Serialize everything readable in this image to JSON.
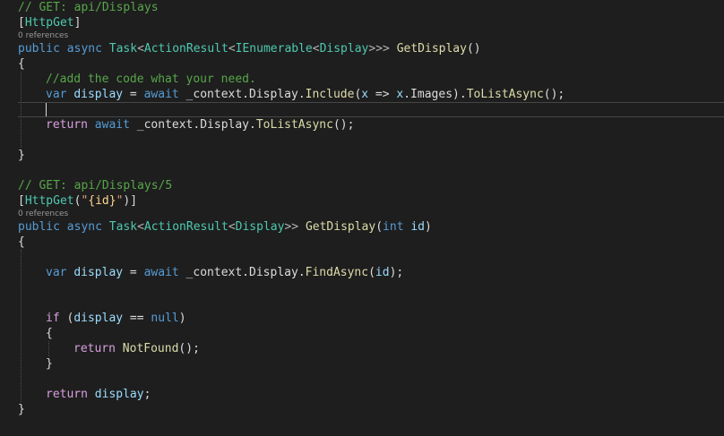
{
  "editor": {
    "colors": {
      "background": "#1e1e1e",
      "comment": "#57a64a",
      "keyword": "#569cd6",
      "control_keyword": "#d8a0df",
      "type": "#4ec9b0",
      "method": "#dcdcaa",
      "variable": "#9cdcfe",
      "string": "#d69d85",
      "plain": "#dcdcdc",
      "codelens": "#999999"
    },
    "lines": [
      {
        "kind": "code",
        "tokens": [
          {
            "t": "// GET: api/Displays",
            "c": "comment"
          }
        ]
      },
      {
        "kind": "code",
        "tokens": [
          {
            "t": "[",
            "c": "plain"
          },
          {
            "t": "HttpGet",
            "c": "attribute"
          },
          {
            "t": "]",
            "c": "plain"
          }
        ]
      },
      {
        "kind": "lens",
        "text": "0 references"
      },
      {
        "kind": "code",
        "tokens": [
          {
            "t": "public",
            "c": "keyword"
          },
          {
            "t": " ",
            "c": "plain"
          },
          {
            "t": "async",
            "c": "keyword"
          },
          {
            "t": " ",
            "c": "plain"
          },
          {
            "t": "Task",
            "c": "type"
          },
          {
            "t": "<",
            "c": "punct"
          },
          {
            "t": "ActionResult",
            "c": "type"
          },
          {
            "t": "<",
            "c": "punct"
          },
          {
            "t": "IEnumerable",
            "c": "type"
          },
          {
            "t": "<",
            "c": "punct"
          },
          {
            "t": "Display",
            "c": "type"
          },
          {
            "t": ">>>",
            "c": "punct"
          },
          {
            "t": " ",
            "c": "plain"
          },
          {
            "t": "GetDisplay",
            "c": "method"
          },
          {
            "t": "()",
            "c": "plain"
          }
        ]
      },
      {
        "kind": "code",
        "tokens": [
          {
            "t": "{",
            "c": "plain"
          }
        ]
      },
      {
        "kind": "code",
        "indent": 1,
        "tokens": [
          {
            "t": "//add the code what your need.",
            "c": "comment"
          }
        ]
      },
      {
        "kind": "code",
        "indent": 1,
        "tokens": [
          {
            "t": "var",
            "c": "keyword"
          },
          {
            "t": " ",
            "c": "plain"
          },
          {
            "t": "display",
            "c": "variable"
          },
          {
            "t": " = ",
            "c": "plain"
          },
          {
            "t": "await",
            "c": "keyword"
          },
          {
            "t": " _context.",
            "c": "plain"
          },
          {
            "t": "Display",
            "c": "plain"
          },
          {
            "t": ".",
            "c": "plain"
          },
          {
            "t": "Include",
            "c": "method"
          },
          {
            "t": "(",
            "c": "plain"
          },
          {
            "t": "x",
            "c": "variable"
          },
          {
            "t": " => ",
            "c": "plain"
          },
          {
            "t": "x",
            "c": "variable"
          },
          {
            "t": ".Images).",
            "c": "plain"
          },
          {
            "t": "ToListAsync",
            "c": "method"
          },
          {
            "t": "();",
            "c": "plain"
          }
        ]
      },
      {
        "kind": "code",
        "indent": 1,
        "current": true,
        "tokens": []
      },
      {
        "kind": "code",
        "indent": 1,
        "tokens": [
          {
            "t": "return",
            "c": "control"
          },
          {
            "t": " ",
            "c": "plain"
          },
          {
            "t": "await",
            "c": "keyword"
          },
          {
            "t": " _context.",
            "c": "plain"
          },
          {
            "t": "Display",
            "c": "plain"
          },
          {
            "t": ".",
            "c": "plain"
          },
          {
            "t": "ToListAsync",
            "c": "method"
          },
          {
            "t": "();",
            "c": "plain"
          }
        ]
      },
      {
        "kind": "code",
        "tokens": []
      },
      {
        "kind": "code",
        "tokens": [
          {
            "t": "}",
            "c": "plain"
          }
        ]
      },
      {
        "kind": "code",
        "tokens": []
      },
      {
        "kind": "code",
        "tokens": [
          {
            "t": "// GET: api/Displays/5",
            "c": "comment"
          }
        ]
      },
      {
        "kind": "code",
        "tokens": [
          {
            "t": "[",
            "c": "plain"
          },
          {
            "t": "HttpGet",
            "c": "attribute"
          },
          {
            "t": "(",
            "c": "plain"
          },
          {
            "t": "\"",
            "c": "string"
          },
          {
            "t": "{id}",
            "c": "format"
          },
          {
            "t": "\"",
            "c": "string"
          },
          {
            "t": ")]",
            "c": "plain"
          }
        ]
      },
      {
        "kind": "lens",
        "text": "0 references"
      },
      {
        "kind": "code",
        "tokens": [
          {
            "t": "public",
            "c": "keyword"
          },
          {
            "t": " ",
            "c": "plain"
          },
          {
            "t": "async",
            "c": "keyword"
          },
          {
            "t": " ",
            "c": "plain"
          },
          {
            "t": "Task",
            "c": "type"
          },
          {
            "t": "<",
            "c": "punct"
          },
          {
            "t": "ActionResult",
            "c": "type"
          },
          {
            "t": "<",
            "c": "punct"
          },
          {
            "t": "Display",
            "c": "type"
          },
          {
            "t": ">>",
            "c": "punct"
          },
          {
            "t": " ",
            "c": "plain"
          },
          {
            "t": "GetDisplay",
            "c": "method"
          },
          {
            "t": "(",
            "c": "plain"
          },
          {
            "t": "int",
            "c": "keyword"
          },
          {
            "t": " ",
            "c": "plain"
          },
          {
            "t": "id",
            "c": "variable"
          },
          {
            "t": ")",
            "c": "plain"
          }
        ]
      },
      {
        "kind": "code",
        "tokens": [
          {
            "t": "{",
            "c": "plain"
          }
        ]
      },
      {
        "kind": "code",
        "tokens": []
      },
      {
        "kind": "code",
        "indent": 1,
        "tokens": [
          {
            "t": "var",
            "c": "keyword"
          },
          {
            "t": " ",
            "c": "plain"
          },
          {
            "t": "display",
            "c": "variable"
          },
          {
            "t": " = ",
            "c": "plain"
          },
          {
            "t": "await",
            "c": "keyword"
          },
          {
            "t": " _context.",
            "c": "plain"
          },
          {
            "t": "Display",
            "c": "plain"
          },
          {
            "t": ".",
            "c": "plain"
          },
          {
            "t": "FindAsync",
            "c": "method"
          },
          {
            "t": "(",
            "c": "plain"
          },
          {
            "t": "id",
            "c": "variable"
          },
          {
            "t": ");",
            "c": "plain"
          }
        ]
      },
      {
        "kind": "code",
        "tokens": []
      },
      {
        "kind": "code",
        "tokens": []
      },
      {
        "kind": "code",
        "indent": 1,
        "tokens": [
          {
            "t": "if",
            "c": "control"
          },
          {
            "t": " (",
            "c": "plain"
          },
          {
            "t": "display",
            "c": "variable"
          },
          {
            "t": " == ",
            "c": "plain"
          },
          {
            "t": "null",
            "c": "keyword"
          },
          {
            "t": ")",
            "c": "plain"
          }
        ]
      },
      {
        "kind": "code",
        "indent": 1,
        "tokens": [
          {
            "t": "{",
            "c": "plain"
          }
        ]
      },
      {
        "kind": "code",
        "indent": 2,
        "tokens": [
          {
            "t": "return",
            "c": "control"
          },
          {
            "t": " ",
            "c": "plain"
          },
          {
            "t": "NotFound",
            "c": "method"
          },
          {
            "t": "();",
            "c": "plain"
          }
        ]
      },
      {
        "kind": "code",
        "indent": 1,
        "tokens": [
          {
            "t": "}",
            "c": "plain"
          }
        ]
      },
      {
        "kind": "code",
        "tokens": []
      },
      {
        "kind": "code",
        "indent": 1,
        "tokens": [
          {
            "t": "return",
            "c": "control"
          },
          {
            "t": " ",
            "c": "plain"
          },
          {
            "t": "display",
            "c": "variable"
          },
          {
            "t": ";",
            "c": "plain"
          }
        ]
      },
      {
        "kind": "code",
        "tokens": [
          {
            "t": "}",
            "c": "plain"
          }
        ]
      }
    ]
  }
}
